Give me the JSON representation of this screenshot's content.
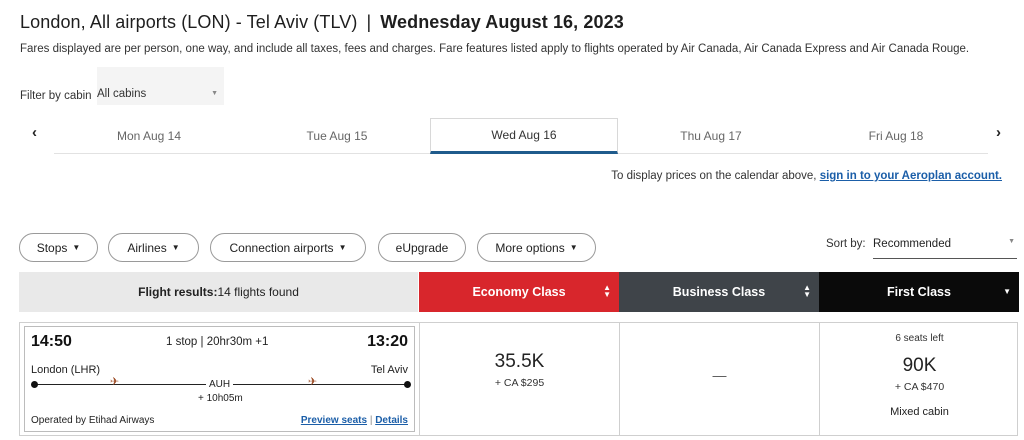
{
  "header": {
    "route": "London, All airports (LON) - Tel Aviv (TLV)",
    "separator": "|",
    "date": "Wednesday August 16, 2023",
    "note": "Fares displayed are per person, one way, and include all taxes, fees and charges. Fare features listed apply to flights operated by Air Canada, Air Canada Express and Air Canada Rouge."
  },
  "filter": {
    "label": "Filter by cabin",
    "value": "All cabins"
  },
  "date_strip": {
    "prev": "‹",
    "next": "›",
    "tabs": [
      {
        "label": "Mon Aug 14"
      },
      {
        "label": "Tue Aug 15"
      },
      {
        "label": "Wed Aug 16",
        "active": true
      },
      {
        "label": "Thu Aug 17"
      },
      {
        "label": "Fri Aug 18"
      }
    ]
  },
  "aeroplan": {
    "text": "To display prices on the calendar above,",
    "link": "sign in to your Aeroplan account."
  },
  "filters": {
    "stops": "Stops",
    "airlines": "Airlines",
    "connections": "Connection airports",
    "eupgrade": "eUpgrade",
    "more": "More options"
  },
  "sort": {
    "label": "Sort by:",
    "value": "Recommended"
  },
  "results_header": {
    "label": "Flight results:",
    "count": "14 flights found",
    "cabins": {
      "economy": "Economy Class",
      "business": "Business Class",
      "first": "First Class"
    }
  },
  "flight": {
    "depart_time": "14:50",
    "arrive_time": "13:20",
    "stops_info": "1 stop | 20hr30m +1",
    "origin": "London (LHR)",
    "destination": "Tel Aviv",
    "connection": "AUH",
    "layover": "+ 10h05m",
    "operated_by": "Operated by Etihad Airways",
    "preview_seats": "Preview seats",
    "link_sep": "|",
    "details": "Details",
    "economy": {
      "points": "35.5K",
      "cash": "+ CA $295"
    },
    "business": {
      "unavailable": "—"
    },
    "first": {
      "seats_left": "6 seats left",
      "points": "90K",
      "cash": "+ CA $470",
      "note": "Mixed cabin"
    }
  },
  "colors": {
    "economy": "#d8262c",
    "business": "#3f4449",
    "first": "#0a0a0a",
    "link": "#1b5ea8",
    "active_tab": "#1f5b8c"
  },
  "icons": [
    "chevron-left-icon",
    "chevron-right-icon",
    "caret-down-icon",
    "sort-icon",
    "plane-icon"
  ]
}
